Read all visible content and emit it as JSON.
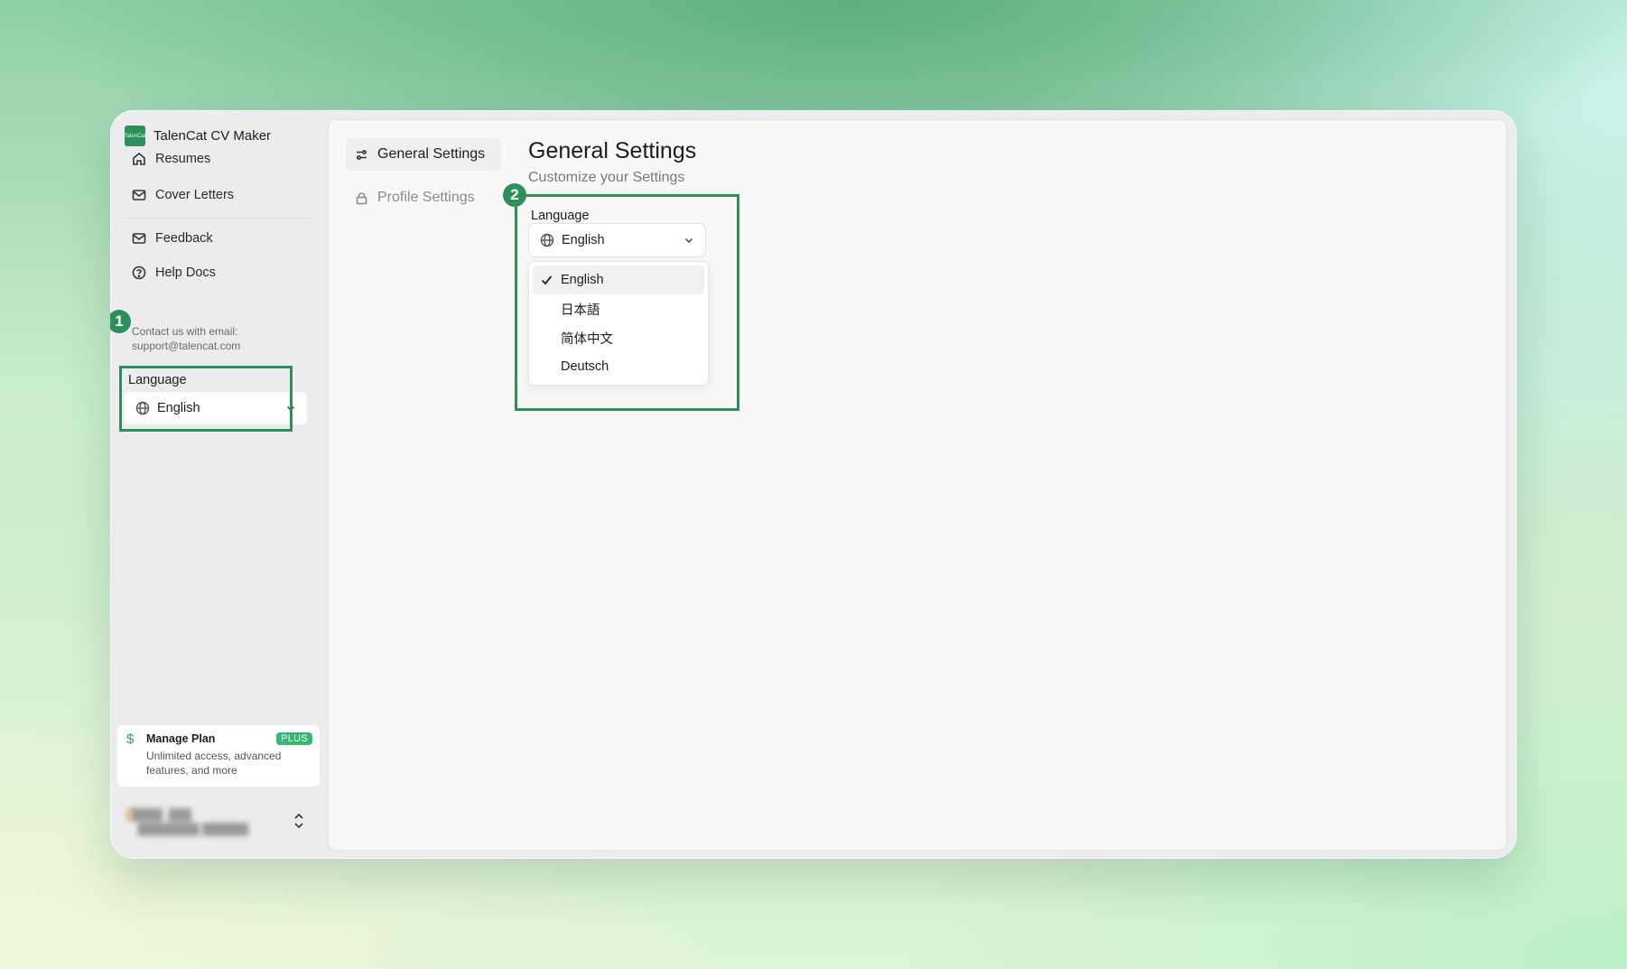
{
  "app": {
    "title": "TalenCat CV Maker",
    "logo_text": "TalenCat"
  },
  "sidebar": {
    "items": [
      {
        "label": "Resumes",
        "icon": "home-icon"
      },
      {
        "label": "Cover Letters",
        "icon": "mail-icon"
      },
      {
        "label": "Feedback",
        "icon": "mail-icon"
      },
      {
        "label": "Help Docs",
        "icon": "help-circle-icon"
      }
    ],
    "contact_line1": "Contact us with email:",
    "contact_line2": "support@talencat.com",
    "language_label": "Language",
    "language_value": "English",
    "plan": {
      "title": "Manage Plan",
      "badge": "PLUS",
      "description": "Unlimited access, advanced features, and more",
      "icon": "dollar-icon"
    }
  },
  "settings_tabs": [
    {
      "label": "General Settings",
      "icon": "sliders-icon",
      "active": true
    },
    {
      "label": "Profile Settings",
      "icon": "lock-icon",
      "active": false
    }
  ],
  "main": {
    "title": "General Settings",
    "subtitle": "Customize your Settings",
    "language_label": "Language",
    "language_value": "English",
    "language_options": [
      "English",
      "日本語",
      "简体中文",
      "Deutsch"
    ],
    "selected_option": "English"
  },
  "annotations": {
    "badge1": "1",
    "badge2": "2",
    "color": "#2f8f5a"
  }
}
